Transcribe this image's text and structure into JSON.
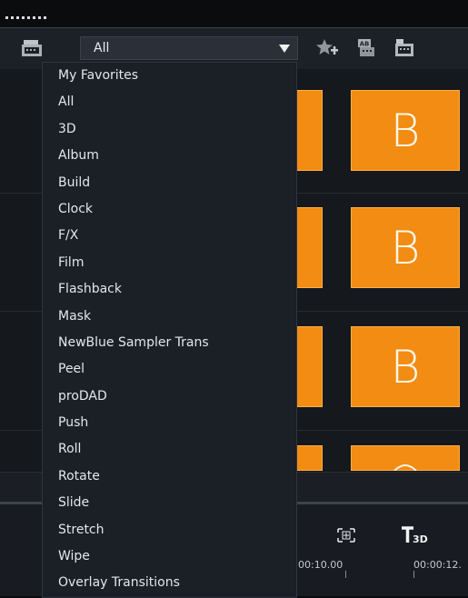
{
  "filter": {
    "selected": "All"
  },
  "menu_items": [
    "My Favorites",
    "All",
    "3D",
    "Album",
    "Build",
    "Clock",
    "F/X",
    "Film",
    "Flashback",
    "Mask",
    "NewBlue Sampler Trans",
    "Peel",
    "proDAD",
    "Push",
    "Roll",
    "Rotate",
    "Slide",
    "Stretch",
    "Wipe",
    "Overlay Transitions"
  ],
  "thumbnail_letter": "B",
  "timeline": {
    "time_1": "00:10.00",
    "time_2": "00:00:12."
  },
  "colors": {
    "accent": "#f28c12",
    "panel": "#1c2027",
    "menu_bg": "#1b1f26"
  }
}
